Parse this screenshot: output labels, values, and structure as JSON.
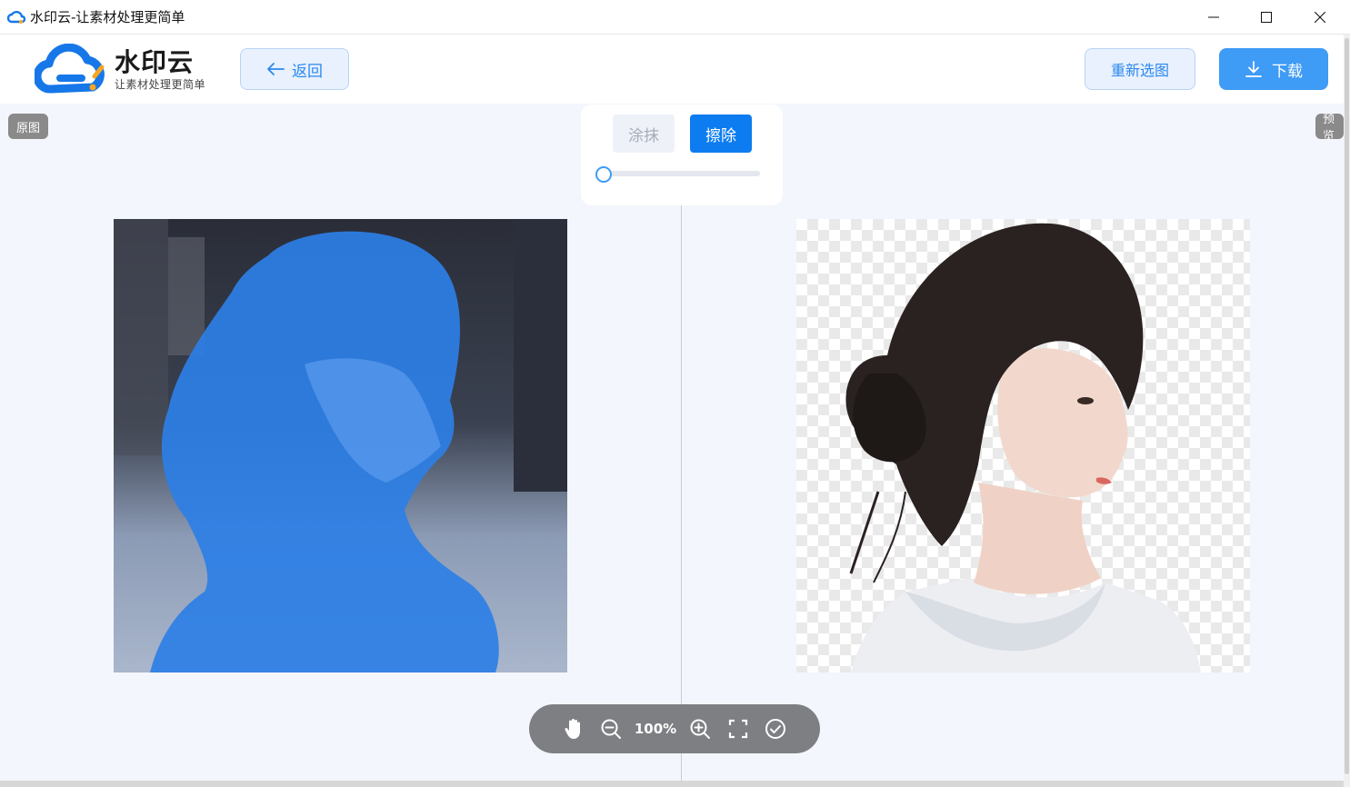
{
  "window": {
    "title": "水印云-让素材处理更简单"
  },
  "header": {
    "logo_name": "水印云",
    "logo_slogan": "让素材处理更简单",
    "back_label": "返回",
    "reselect_label": "重新选图",
    "download_label": "下载"
  },
  "panels": {
    "original_label": "原图",
    "preview_label": "预览"
  },
  "brush": {
    "paint_label": "涂抹",
    "erase_label": "擦除",
    "active_mode": "erase",
    "size_fraction": 0.0
  },
  "toolbar": {
    "zoom_label": "100%",
    "icons": [
      "hand-icon",
      "zoom-out-icon",
      "zoom-in-icon",
      "fullscreen-icon",
      "check-circle-icon"
    ]
  },
  "colors": {
    "accent": "#3e9bf6",
    "active_button": "#0c7cf0",
    "mask_overlay": "#2d7fe6"
  }
}
